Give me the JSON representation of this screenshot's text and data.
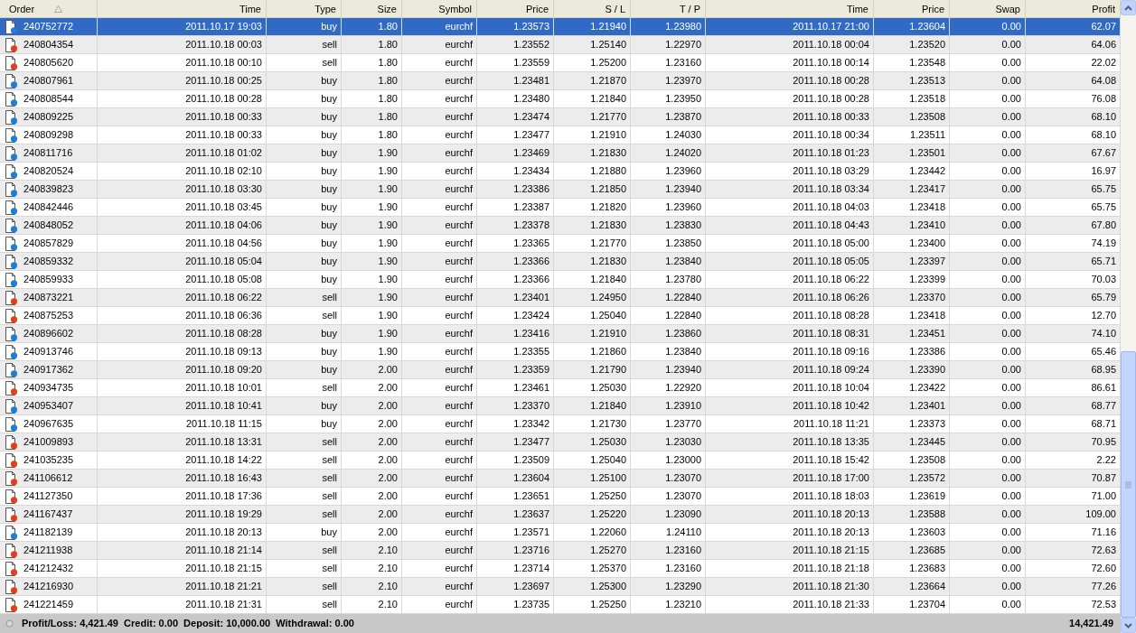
{
  "table": {
    "columns": [
      {
        "label": "Order",
        "sorted": true
      },
      {
        "label": "Time",
        "sorted": false
      },
      {
        "label": "Type",
        "sorted": false
      },
      {
        "label": "Size",
        "sorted": false
      },
      {
        "label": "Symbol",
        "sorted": false
      },
      {
        "label": "Price",
        "sorted": false
      },
      {
        "label": "S / L",
        "sorted": false
      },
      {
        "label": "T / P",
        "sorted": false
      },
      {
        "label": "Time",
        "sorted": false
      },
      {
        "label": "Price",
        "sorted": false
      },
      {
        "label": "Swap",
        "sorted": false
      },
      {
        "label": "Profit",
        "sorted": false
      }
    ],
    "rows": [
      {
        "selected": true,
        "kind": "buy",
        "cells": [
          "240752772",
          "2011.10.17 19:03",
          "buy",
          "1.80",
          "eurchf",
          "1.23573",
          "1.21940",
          "1.23980",
          "2011.10.17 21:00",
          "1.23604",
          "0.00",
          "62.07"
        ]
      },
      {
        "selected": false,
        "kind": "sell",
        "cells": [
          "240804354",
          "2011.10.18 00:03",
          "sell",
          "1.80",
          "eurchf",
          "1.23552",
          "1.25140",
          "1.22970",
          "2011.10.18 00:04",
          "1.23520",
          "0.00",
          "64.06"
        ]
      },
      {
        "selected": false,
        "kind": "sell",
        "cells": [
          "240805620",
          "2011.10.18 00:10",
          "sell",
          "1.80",
          "eurchf",
          "1.23559",
          "1.25200",
          "1.23160",
          "2011.10.18 00:14",
          "1.23548",
          "0.00",
          "22.02"
        ]
      },
      {
        "selected": false,
        "kind": "buy",
        "cells": [
          "240807961",
          "2011.10.18 00:25",
          "buy",
          "1.80",
          "eurchf",
          "1.23481",
          "1.21870",
          "1.23970",
          "2011.10.18 00:28",
          "1.23513",
          "0.00",
          "64.08"
        ]
      },
      {
        "selected": false,
        "kind": "buy",
        "cells": [
          "240808544",
          "2011.10.18 00:28",
          "buy",
          "1.80",
          "eurchf",
          "1.23480",
          "1.21840",
          "1.23950",
          "2011.10.18 00:28",
          "1.23518",
          "0.00",
          "76.08"
        ]
      },
      {
        "selected": false,
        "kind": "buy",
        "cells": [
          "240809225",
          "2011.10.18 00:33",
          "buy",
          "1.80",
          "eurchf",
          "1.23474",
          "1.21770",
          "1.23870",
          "2011.10.18 00:33",
          "1.23508",
          "0.00",
          "68.10"
        ]
      },
      {
        "selected": false,
        "kind": "buy",
        "cells": [
          "240809298",
          "2011.10.18 00:33",
          "buy",
          "1.80",
          "eurchf",
          "1.23477",
          "1.21910",
          "1.24030",
          "2011.10.18 00:34",
          "1.23511",
          "0.00",
          "68.10"
        ]
      },
      {
        "selected": false,
        "kind": "buy",
        "cells": [
          "240811716",
          "2011.10.18 01:02",
          "buy",
          "1.90",
          "eurchf",
          "1.23469",
          "1.21830",
          "1.24020",
          "2011.10.18 01:23",
          "1.23501",
          "0.00",
          "67.67"
        ]
      },
      {
        "selected": false,
        "kind": "buy",
        "cells": [
          "240820524",
          "2011.10.18 02:10",
          "buy",
          "1.90",
          "eurchf",
          "1.23434",
          "1.21880",
          "1.23960",
          "2011.10.18 03:29",
          "1.23442",
          "0.00",
          "16.97"
        ]
      },
      {
        "selected": false,
        "kind": "buy",
        "cells": [
          "240839823",
          "2011.10.18 03:30",
          "buy",
          "1.90",
          "eurchf",
          "1.23386",
          "1.21850",
          "1.23940",
          "2011.10.18 03:34",
          "1.23417",
          "0.00",
          "65.75"
        ]
      },
      {
        "selected": false,
        "kind": "buy",
        "cells": [
          "240842446",
          "2011.10.18 03:45",
          "buy",
          "1.90",
          "eurchf",
          "1.23387",
          "1.21820",
          "1.23960",
          "2011.10.18 04:03",
          "1.23418",
          "0.00",
          "65.75"
        ]
      },
      {
        "selected": false,
        "kind": "buy",
        "cells": [
          "240848052",
          "2011.10.18 04:06",
          "buy",
          "1.90",
          "eurchf",
          "1.23378",
          "1.21830",
          "1.23830",
          "2011.10.18 04:43",
          "1.23410",
          "0.00",
          "67.80"
        ]
      },
      {
        "selected": false,
        "kind": "buy",
        "cells": [
          "240857829",
          "2011.10.18 04:56",
          "buy",
          "1.90",
          "eurchf",
          "1.23365",
          "1.21770",
          "1.23850",
          "2011.10.18 05:00",
          "1.23400",
          "0.00",
          "74.19"
        ]
      },
      {
        "selected": false,
        "kind": "buy",
        "cells": [
          "240859332",
          "2011.10.18 05:04",
          "buy",
          "1.90",
          "eurchf",
          "1.23366",
          "1.21830",
          "1.23840",
          "2011.10.18 05:05",
          "1.23397",
          "0.00",
          "65.71"
        ]
      },
      {
        "selected": false,
        "kind": "buy",
        "cells": [
          "240859933",
          "2011.10.18 05:08",
          "buy",
          "1.90",
          "eurchf",
          "1.23366",
          "1.21840",
          "1.23780",
          "2011.10.18 06:22",
          "1.23399",
          "0.00",
          "70.03"
        ]
      },
      {
        "selected": false,
        "kind": "sell",
        "cells": [
          "240873221",
          "2011.10.18 06:22",
          "sell",
          "1.90",
          "eurchf",
          "1.23401",
          "1.24950",
          "1.22840",
          "2011.10.18 06:26",
          "1.23370",
          "0.00",
          "65.79"
        ]
      },
      {
        "selected": false,
        "kind": "sell",
        "cells": [
          "240875253",
          "2011.10.18 06:36",
          "sell",
          "1.90",
          "eurchf",
          "1.23424",
          "1.25040",
          "1.22840",
          "2011.10.18 08:28",
          "1.23418",
          "0.00",
          "12.70"
        ]
      },
      {
        "selected": false,
        "kind": "buy",
        "cells": [
          "240896602",
          "2011.10.18 08:28",
          "buy",
          "1.90",
          "eurchf",
          "1.23416",
          "1.21910",
          "1.23860",
          "2011.10.18 08:31",
          "1.23451",
          "0.00",
          "74.10"
        ]
      },
      {
        "selected": false,
        "kind": "buy",
        "cells": [
          "240913746",
          "2011.10.18 09:13",
          "buy",
          "1.90",
          "eurchf",
          "1.23355",
          "1.21860",
          "1.23840",
          "2011.10.18 09:16",
          "1.23386",
          "0.00",
          "65.46"
        ]
      },
      {
        "selected": false,
        "kind": "buy",
        "cells": [
          "240917362",
          "2011.10.18 09:20",
          "buy",
          "2.00",
          "eurchf",
          "1.23359",
          "1.21790",
          "1.23940",
          "2011.10.18 09:24",
          "1.23390",
          "0.00",
          "68.95"
        ]
      },
      {
        "selected": false,
        "kind": "sell",
        "cells": [
          "240934735",
          "2011.10.18 10:01",
          "sell",
          "2.00",
          "eurchf",
          "1.23461",
          "1.25030",
          "1.22920",
          "2011.10.18 10:04",
          "1.23422",
          "0.00",
          "86.61"
        ]
      },
      {
        "selected": false,
        "kind": "buy",
        "cells": [
          "240953407",
          "2011.10.18 10:41",
          "buy",
          "2.00",
          "eurchf",
          "1.23370",
          "1.21840",
          "1.23910",
          "2011.10.18 10:42",
          "1.23401",
          "0.00",
          "68.77"
        ]
      },
      {
        "selected": false,
        "kind": "buy",
        "cells": [
          "240967635",
          "2011.10.18 11:15",
          "buy",
          "2.00",
          "eurchf",
          "1.23342",
          "1.21730",
          "1.23770",
          "2011.10.18 11:21",
          "1.23373",
          "0.00",
          "68.71"
        ]
      },
      {
        "selected": false,
        "kind": "sell",
        "cells": [
          "241009893",
          "2011.10.18 13:31",
          "sell",
          "2.00",
          "eurchf",
          "1.23477",
          "1.25030",
          "1.23030",
          "2011.10.18 13:35",
          "1.23445",
          "0.00",
          "70.95"
        ]
      },
      {
        "selected": false,
        "kind": "sell",
        "cells": [
          "241035235",
          "2011.10.18 14:22",
          "sell",
          "2.00",
          "eurchf",
          "1.23509",
          "1.25040",
          "1.23000",
          "2011.10.18 15:42",
          "1.23508",
          "0.00",
          "2.22"
        ]
      },
      {
        "selected": false,
        "kind": "sell",
        "cells": [
          "241106612",
          "2011.10.18 16:43",
          "sell",
          "2.00",
          "eurchf",
          "1.23604",
          "1.25100",
          "1.23070",
          "2011.10.18 17:00",
          "1.23572",
          "0.00",
          "70.87"
        ]
      },
      {
        "selected": false,
        "kind": "sell",
        "cells": [
          "241127350",
          "2011.10.18 17:36",
          "sell",
          "2.00",
          "eurchf",
          "1.23651",
          "1.25250",
          "1.23070",
          "2011.10.18 18:03",
          "1.23619",
          "0.00",
          "71.00"
        ]
      },
      {
        "selected": false,
        "kind": "sell",
        "cells": [
          "241167437",
          "2011.10.18 19:29",
          "sell",
          "2.00",
          "eurchf",
          "1.23637",
          "1.25220",
          "1.23090",
          "2011.10.18 20:13",
          "1.23588",
          "0.00",
          "109.00"
        ]
      },
      {
        "selected": false,
        "kind": "buy",
        "cells": [
          "241182139",
          "2011.10.18 20:13",
          "buy",
          "2.00",
          "eurchf",
          "1.23571",
          "1.22060",
          "1.24110",
          "2011.10.18 20:13",
          "1.23603",
          "0.00",
          "71.16"
        ]
      },
      {
        "selected": false,
        "kind": "sell",
        "cells": [
          "241211938",
          "2011.10.18 21:14",
          "sell",
          "2.10",
          "eurchf",
          "1.23716",
          "1.25270",
          "1.23160",
          "2011.10.18 21:15",
          "1.23685",
          "0.00",
          "72.63"
        ]
      },
      {
        "selected": false,
        "kind": "sell",
        "cells": [
          "241212432",
          "2011.10.18 21:15",
          "sell",
          "2.10",
          "eurchf",
          "1.23714",
          "1.25370",
          "1.23160",
          "2011.10.18 21:18",
          "1.23683",
          "0.00",
          "72.60"
        ]
      },
      {
        "selected": false,
        "kind": "sell",
        "cells": [
          "241216930",
          "2011.10.18 21:21",
          "sell",
          "2.10",
          "eurchf",
          "1.23697",
          "1.25300",
          "1.23290",
          "2011.10.18 21:30",
          "1.23664",
          "0.00",
          "77.26"
        ]
      },
      {
        "selected": false,
        "kind": "sell",
        "cells": [
          "241221459",
          "2011.10.18 21:31",
          "sell",
          "2.10",
          "eurchf",
          "1.23735",
          "1.25250",
          "1.23210",
          "2011.10.18 21:33",
          "1.23704",
          "0.00",
          "72.53"
        ]
      }
    ]
  },
  "summary": {
    "text": "Profit/Loss: 4,421.49  Credit: 0.00  Deposit: 10,000.00  Withdrawal: 0.00",
    "total": "14,421.49"
  }
}
